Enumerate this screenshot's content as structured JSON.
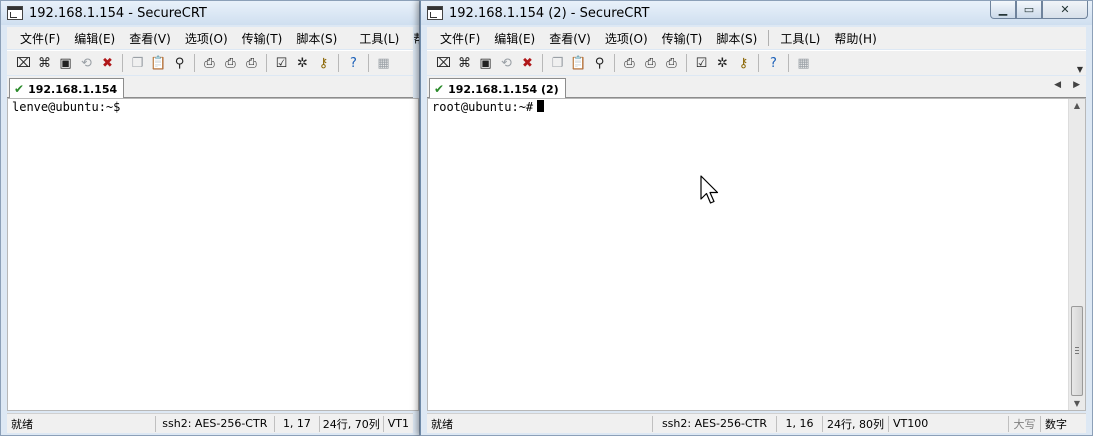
{
  "window_left": {
    "title": "192.168.1.154 - SecureCRT",
    "menu": [
      "文件(F)",
      "编辑(E)",
      "查看(V)",
      "选项(O)",
      "传输(T)",
      "脚本(S)",
      "工具(L)",
      "帮助(H"
    ],
    "tab_label": "192.168.1.154",
    "terminal_line": "lenve@ubuntu:~$",
    "status": {
      "ready": "就绪",
      "cipher": "ssh2: AES-256-CTR",
      "cursor_pos": "1, 17",
      "size": "24行, 70列",
      "term_type": "VT1"
    }
  },
  "window_right": {
    "title": "192.168.1.154 (2) - SecureCRT",
    "menu": [
      "文件(F)",
      "编辑(E)",
      "查看(V)",
      "选项(O)",
      "传输(T)",
      "脚本(S)",
      "工具(L)",
      "帮助(H)"
    ],
    "tab_label": "192.168.1.154 (2)",
    "terminal_line": "root@ubuntu:~#",
    "status": {
      "ready": "就绪",
      "cipher": "ssh2: AES-256-CTR",
      "cursor_pos": "1, 16",
      "size": "24行, 80列",
      "term_type": "VT100",
      "caps": "大写",
      "num": "数字"
    }
  },
  "window_controls": {
    "minimize": "▁",
    "maximize": "▭",
    "close": "✕"
  },
  "icons": {
    "toolbar": [
      "connect-icon",
      "quick-connect-icon",
      "connect-in-tab-icon",
      "reconnect-icon",
      "disconnect-icon",
      "copy-icon",
      "paste-icon",
      "find-icon",
      "print-icon",
      "print-setup-icon",
      "print-selection-icon",
      "session-options-icon",
      "global-options-icon",
      "key-icon",
      "help-icon",
      "unknown-icon"
    ],
    "tab_status": "check-icon",
    "cursor": "mouse-pointer-icon"
  },
  "colors": {
    "title_bar": "#dde8f4",
    "tab_check": "#2a8a2a",
    "disconnect_red": "#b0181a"
  }
}
